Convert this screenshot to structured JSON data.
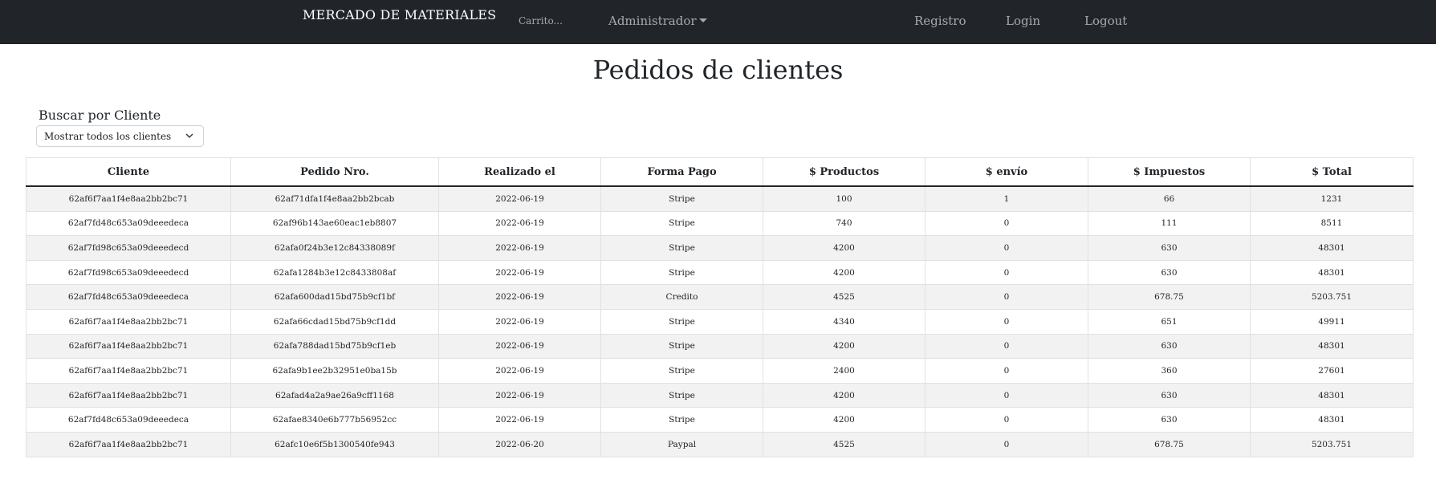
{
  "navbar": {
    "brand": "MERCADO DE MATERIALES",
    "cart": "Carrito...",
    "admin": "Administrador",
    "register": "Registro",
    "login": "Login",
    "logout": "Logout"
  },
  "page": {
    "title": "Pedidos de clientes"
  },
  "filter": {
    "label": "Buscar por Cliente",
    "selected": "Mostrar todos los clientes"
  },
  "table": {
    "headers": [
      "Cliente",
      "Pedido Nro.",
      "Realizado el",
      "Forma Pago",
      "$ Productos",
      "$ envío",
      "$ Impuestos",
      "$ Total"
    ],
    "rows": [
      [
        "62af6f7aa1f4e8aa2bb2bc71",
        "62af71dfa1f4e8aa2bb2bcab",
        "2022-06-19",
        "Stripe",
        "100",
        "1",
        "66",
        "1231"
      ],
      [
        "62af7fd48c653a09deeedeca",
        "62af96b143ae60eac1eb8807",
        "2022-06-19",
        "Stripe",
        "740",
        "0",
        "111",
        "8511"
      ],
      [
        "62af7fd98c653a09deeedecd",
        "62afa0f24b3e12c84338089f",
        "2022-06-19",
        "Stripe",
        "4200",
        "0",
        "630",
        "48301"
      ],
      [
        "62af7fd98c653a09deeedecd",
        "62afa1284b3e12c8433808af",
        "2022-06-19",
        "Stripe",
        "4200",
        "0",
        "630",
        "48301"
      ],
      [
        "62af7fd48c653a09deeedeca",
        "62afa600dad15bd75b9cf1bf",
        "2022-06-19",
        "Credito",
        "4525",
        "0",
        "678.75",
        "5203.751"
      ],
      [
        "62af6f7aa1f4e8aa2bb2bc71",
        "62afa66cdad15bd75b9cf1dd",
        "2022-06-19",
        "Stripe",
        "4340",
        "0",
        "651",
        "49911"
      ],
      [
        "62af6f7aa1f4e8aa2bb2bc71",
        "62afa788dad15bd75b9cf1eb",
        "2022-06-19",
        "Stripe",
        "4200",
        "0",
        "630",
        "48301"
      ],
      [
        "62af6f7aa1f4e8aa2bb2bc71",
        "62afa9b1ee2b32951e0ba15b",
        "2022-06-19",
        "Stripe",
        "2400",
        "0",
        "360",
        "27601"
      ],
      [
        "62af6f7aa1f4e8aa2bb2bc71",
        "62afad4a2a9ae26a9cff1168",
        "2022-06-19",
        "Stripe",
        "4200",
        "0",
        "630",
        "48301"
      ],
      [
        "62af7fd48c653a09deeedeca",
        "62afae8340e6b777b56952cc",
        "2022-06-19",
        "Stripe",
        "4200",
        "0",
        "630",
        "48301"
      ],
      [
        "62af6f7aa1f4e8aa2bb2bc71",
        "62afc10e6f5b1300540fe943",
        "2022-06-20",
        "Paypal",
        "4525",
        "0",
        "678.75",
        "5203.751"
      ]
    ]
  },
  "icons": {
    "admin_dropdown": "caret-down-icon",
    "filter_select": "chevron-down-icon"
  },
  "colors": {
    "navbar_bg": "#212529",
    "nav_text": "#ffffff",
    "row_stripe": "#f2f2f2"
  }
}
